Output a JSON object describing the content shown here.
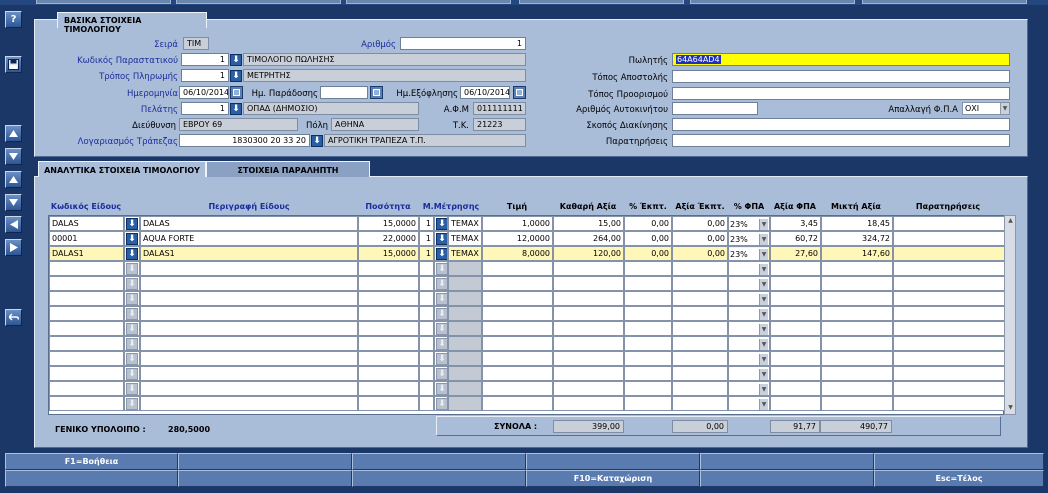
{
  "toolbar": {
    "help_label": "?",
    "save_label": "",
    "nav_up_label": "",
    "nav_down_label": ""
  },
  "header_section": {
    "title": "ΒΑΣΙΚΑ ΣΤΟΙΧΕΙΑ ΤΙΜΟΛΟΓΙΟΥ",
    "seira_label": "Σειρά",
    "seira_value": "ΤΙΜ",
    "arithmos_label": "Αριθμός",
    "arithmos_value": "1",
    "kodikos_label": "Κωδικός Παραστατικού",
    "kodikos_value": "1",
    "kodikos_desc": "ΤΙΜΟΛΟΓΙΟ ΠΩΛΗΣΗΣ",
    "tropos_label": "Τρόπος Πληρωμής",
    "tropos_value": "1",
    "tropos_desc": "ΜΕΤΡΗΤΗΣ",
    "date_label": "Ημερομηνία",
    "date_value": "06/10/2014",
    "paradosi_label": "Ημ. Παράδοσης",
    "paradosi_value": "",
    "exoflisi_label": "Ημ.Εξόφλησης",
    "exoflisi_value": "06/10/2014",
    "pelatis_label": "Πελάτης",
    "pelatis_value": "1",
    "pelatis_desc": "ΟΠΑΔ (ΔΗΜΟΣΙΟ)",
    "afm_label": "Α.Φ.Μ",
    "afm_value": "011111111",
    "dieuthinsi_label": "Διεύθυνση",
    "dieuthinsi_value": "ΕΒΡΟΥ 69",
    "poli_label": "Πόλη",
    "poli_value": "ΑΘΗΝΑ",
    "tk_label": "Τ.Κ.",
    "tk_value": "21223",
    "trapeza_label": "Λογαριασμός Τράπεζας",
    "trapeza_value": "1830300 20 33 20",
    "trapeza_desc": "ΑΓΡΟΤΙΚΗ ΤΡΑΠΕΖΑ Τ.Π.",
    "politis_label": "Πωλητής",
    "politis_value": "64A64AD4",
    "topos_apostolis_label": "Τόπος Αποστολής",
    "topos_apostolis_value": "",
    "topos_proorismou_label": "Τόπος Προορισμού",
    "topos_proorismou_value": "",
    "autokinitou_label": "Αριθμός Αυτοκινήτου",
    "autokinitou_value": "",
    "apallagi_label": "Απαλλαγή Φ.Π.Α",
    "apallagi_value": "ΟΧΙ",
    "skopos_label": "Σκοπός Διακίνησης",
    "skopos_value": "",
    "paratiriseis_label": "Παρατηρήσεις",
    "paratiriseis_value": ""
  },
  "tabs": [
    {
      "label": "ΑΝΑΛΥΤΙΚΑ ΣΤΟΙΧΕΙΑ ΤΙΜΟΛΟΓΙΟΥ",
      "active": true
    },
    {
      "label": "ΣΤΟΙΧΕΙΑ ΠΑΡΑΛΗΠΤΗ",
      "active": false
    }
  ],
  "lines_table": {
    "columns": [
      "Κωδικός Είδους",
      "Περιγραφή Είδους",
      "Ποσότητα",
      "Μ.Μέτρησης",
      "Τιμή",
      "Καθαρή Αξία",
      "% Έκπτ.",
      "Αξία Έκπτ.",
      "% ΦΠΑ",
      "Αξία ΦΠΑ",
      "Μικτή Αξία",
      "Παρατηρήσεις"
    ],
    "rows": [
      {
        "code": "DALAS",
        "desc": "DALAS",
        "qty": "15,0000",
        "unit_no": "1",
        "unit": "ΤΕΜΑΧ",
        "price": "1,0000",
        "net": "15,00",
        "disc_pct": "0,00",
        "disc_val": "0,00",
        "vat_pct": "23%",
        "vat_val": "3,45",
        "gross": "18,45",
        "notes": ""
      },
      {
        "code": "00001",
        "desc": "AQUA FORTE",
        "qty": "22,0000",
        "unit_no": "1",
        "unit": "ΤΕΜΑΧ",
        "price": "12,0000",
        "net": "264,00",
        "disc_pct": "0,00",
        "disc_val": "0,00",
        "vat_pct": "23%",
        "vat_val": "60,72",
        "gross": "324,72",
        "notes": ""
      },
      {
        "code": "DALAS1",
        "desc": "DALAS1",
        "qty": "15,0000",
        "unit_no": "1",
        "unit": "ΤΕΜΑΧ",
        "price": "8,0000",
        "net": "120,00",
        "disc_pct": "0,00",
        "disc_val": "0,00",
        "vat_pct": "23%",
        "vat_val": "27,60",
        "gross": "147,60",
        "notes": ""
      }
    ],
    "empty_rows": 10
  },
  "footer": {
    "balance_label": "ΓΕΝΙΚΟ ΥΠΟΛΟΙΠΟ :",
    "balance_value": "280,5000",
    "totals_label": "ΣΥΝΟΛΑ :",
    "total_net": "399,00",
    "total_disc": "0,00",
    "total_vat": "91,77",
    "total_gross": "490,77"
  },
  "fkeys": {
    "f1": "F1=Βοήθεια",
    "f10": "F10=Καταχώριση",
    "esc": "Esc=Τέλος"
  },
  "colors": {
    "background": "#1b3768",
    "panel": "#a9bcd8",
    "label_blue": "#1b2d9c",
    "highlight_yellow": "#ffff00",
    "selected_row": "#fff7b8"
  }
}
